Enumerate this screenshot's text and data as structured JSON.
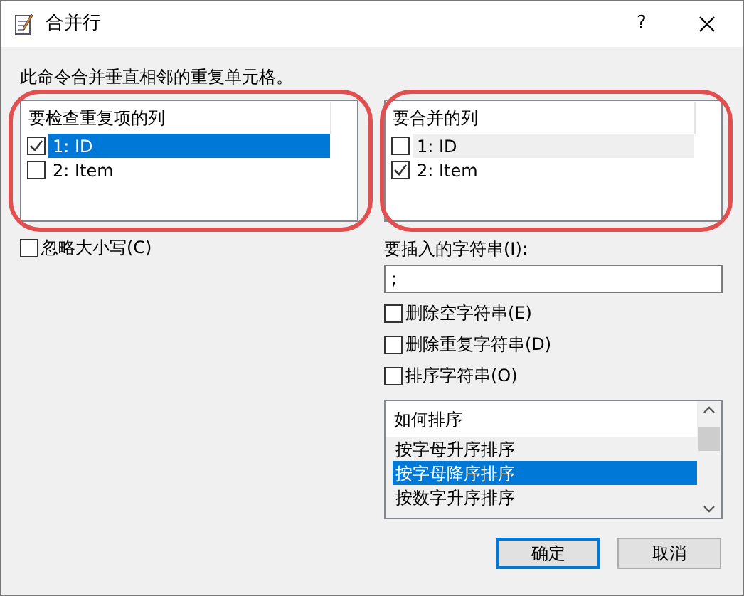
{
  "window": {
    "title": "合并行",
    "help": "?"
  },
  "description": "此命令合并垂直相邻的重复单元格。",
  "lists": [
    {
      "header": "要检查重复项的列",
      "focused": true,
      "items": [
        {
          "label": "1: ID",
          "checked": true,
          "selected": true
        },
        {
          "label": "2: Item",
          "checked": false,
          "selected": false
        }
      ]
    },
    {
      "header": "要合并的列",
      "focused": false,
      "items": [
        {
          "label": "1: ID",
          "checked": false,
          "selected": true
        },
        {
          "label": "2: Item",
          "checked": true,
          "selected": false
        }
      ]
    }
  ],
  "ignore_case": {
    "label": "忽略大小写(C)",
    "checked": false
  },
  "insert": {
    "label": "要插入的字符串(I):",
    "value": ";"
  },
  "options": [
    {
      "label": "删除空字符串(E)",
      "checked": false
    },
    {
      "label": "删除重复字符串(D)",
      "checked": false
    },
    {
      "label": "排序字符串(O)",
      "checked": false
    }
  ],
  "sort": {
    "header": "如何排序",
    "items": [
      {
        "label": "按字母升序排序",
        "selected": false
      },
      {
        "label": "按字母降序排序",
        "selected": true
      },
      {
        "label": "按数字升序排序",
        "selected": false
      }
    ]
  },
  "buttons": [
    {
      "label": "确定",
      "default": true
    },
    {
      "label": "取消",
      "default": false
    }
  ]
}
